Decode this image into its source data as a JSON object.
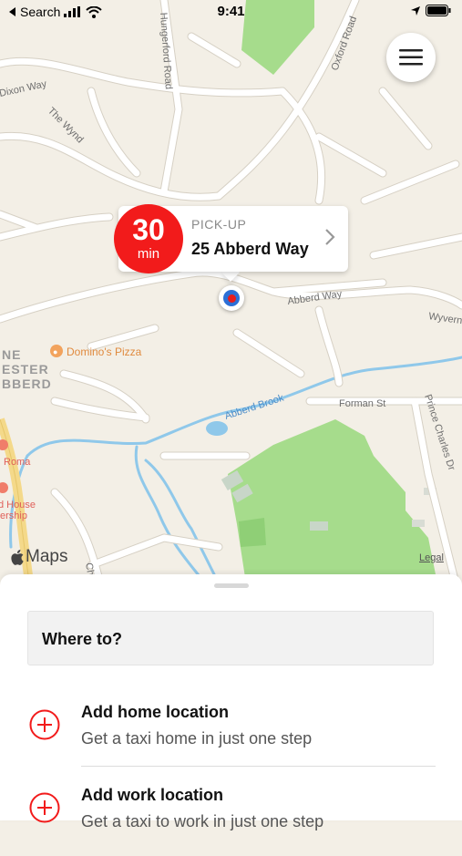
{
  "status_bar": {
    "back_label": "Search",
    "time": "9:41"
  },
  "map": {
    "street_labels": {
      "hungerford": "Hungerford Road",
      "oxford": "Oxford Road",
      "dixon": "Dixon Way",
      "wynd": "The Wynd",
      "abberd_way": "Abberd Way",
      "wyvern": "Wyvern",
      "abberd_brook": "Abberd Brook",
      "forman": "Forman St",
      "prince_charles": "Prince Charles Dr",
      "ch": "Ch"
    },
    "area_labels": {
      "line1": "NE",
      "line2": "ESTER",
      "line3": "BBERD"
    },
    "poi": {
      "dominos": "Domino's Pizza",
      "roma": "Roma",
      "house1": "d House",
      "house2": "ership"
    },
    "maps_label": "Maps",
    "legal_label": "Legal"
  },
  "pickup": {
    "eta_value": "30",
    "eta_unit": "min",
    "label": "PICK-UP",
    "address": "25 Abberd Way"
  },
  "sheet": {
    "search_placeholder": "Where to?",
    "rows": [
      {
        "title": "Add home location",
        "subtitle": "Get a taxi home in just one step"
      },
      {
        "title": "Add work location",
        "subtitle": "Get a taxi to work in just one step"
      }
    ]
  },
  "colors": {
    "accent": "#f21b1b",
    "map_bg": "#f3efe6",
    "park": "#a6dc8c",
    "water": "#8fc8ea",
    "road": "#ffffff",
    "road_edge": "#d6d0c4"
  },
  "icons": [
    "back-arrow-icon",
    "signal-icon",
    "wifi-icon",
    "location-arrow-icon",
    "battery-icon",
    "hamburger-menu-icon",
    "chevron-right-icon",
    "location-pin-icon",
    "apple-logo-icon",
    "add-circle-icon"
  ]
}
